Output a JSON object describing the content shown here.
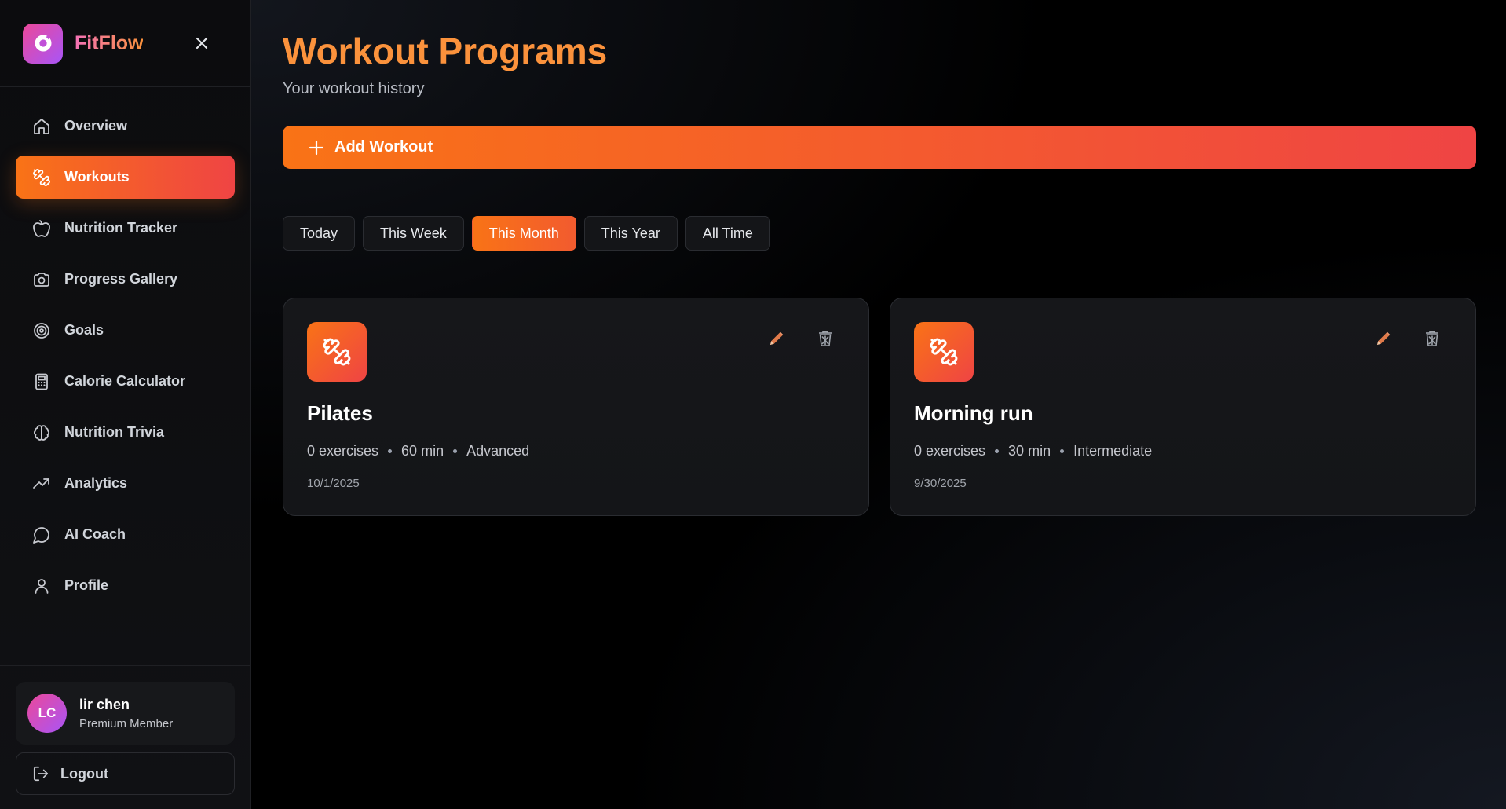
{
  "brand": {
    "name": "FitFlow"
  },
  "nav": {
    "items": [
      {
        "label": "Overview",
        "icon": "home-icon"
      },
      {
        "label": "Workouts",
        "icon": "dumbbell-icon",
        "active": true
      },
      {
        "label": "Nutrition Tracker",
        "icon": "apple-icon"
      },
      {
        "label": "Progress Gallery",
        "icon": "camera-icon"
      },
      {
        "label": "Goals",
        "icon": "target-icon"
      },
      {
        "label": "Calorie Calculator",
        "icon": "calculator-icon"
      },
      {
        "label": "Nutrition Trivia",
        "icon": "brain-icon"
      },
      {
        "label": "Analytics",
        "icon": "trending-up-icon"
      },
      {
        "label": "AI Coach",
        "icon": "chat-bubble-icon"
      },
      {
        "label": "Profile",
        "icon": "user-icon"
      }
    ]
  },
  "user": {
    "initials": "LC",
    "name": "lir chen",
    "role": "Premium Member"
  },
  "logout": {
    "label": "Logout"
  },
  "page": {
    "title": "Workout Programs",
    "subtitle": "Your workout history",
    "add_label": "Add Workout"
  },
  "filters": {
    "items": [
      "Today",
      "This Week",
      "This Month",
      "This Year",
      "All Time"
    ],
    "active": "This Month"
  },
  "workouts": [
    {
      "name": "Pilates",
      "exercises": "0 exercises",
      "duration": "60 min",
      "level": "Advanced",
      "date": "10/1/2025"
    },
    {
      "name": "Morning run",
      "exercises": "0 exercises",
      "duration": "30 min",
      "level": "Intermediate",
      "date": "9/30/2025"
    }
  ],
  "colors": {
    "accent_start": "#f97316",
    "accent_end": "#ef4444",
    "title": "#fb923c",
    "brand_start": "#ec4899",
    "brand_end": "#a855f7"
  }
}
